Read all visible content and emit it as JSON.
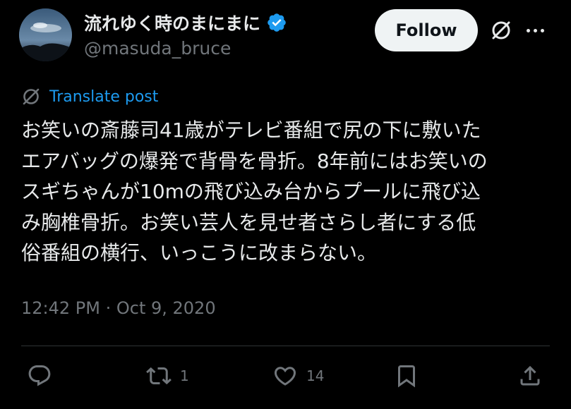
{
  "author": {
    "display_name": "流れゆく時のまにまに",
    "handle": "@masuda_bruce",
    "verified": true
  },
  "header": {
    "follow_label": "Follow"
  },
  "translate": {
    "label": "Translate post"
  },
  "tweet": {
    "lines": [
      "お笑いの斎藤司41歳がテレビ番組で尻の下に敷いた",
      "エアバッグの爆発で背骨を骨折。8年前にはお笑いの",
      "スギちゃんが10mの飛び込み台からプールに飛び込",
      "み胸椎骨折。お笑い芸人を見せ者さらし者にする低",
      "俗番組の横行、いっこうに改まらない。"
    ],
    "timestamp": "12:42 PM · Oct 9, 2020"
  },
  "actions": {
    "reply_count": "",
    "repost_count": "1",
    "like_count": "14"
  },
  "colors": {
    "background": "#000000",
    "text": "#e7e9ea",
    "muted": "#71767b",
    "link": "#1d9bf0",
    "verified": "#1d9bf0"
  }
}
